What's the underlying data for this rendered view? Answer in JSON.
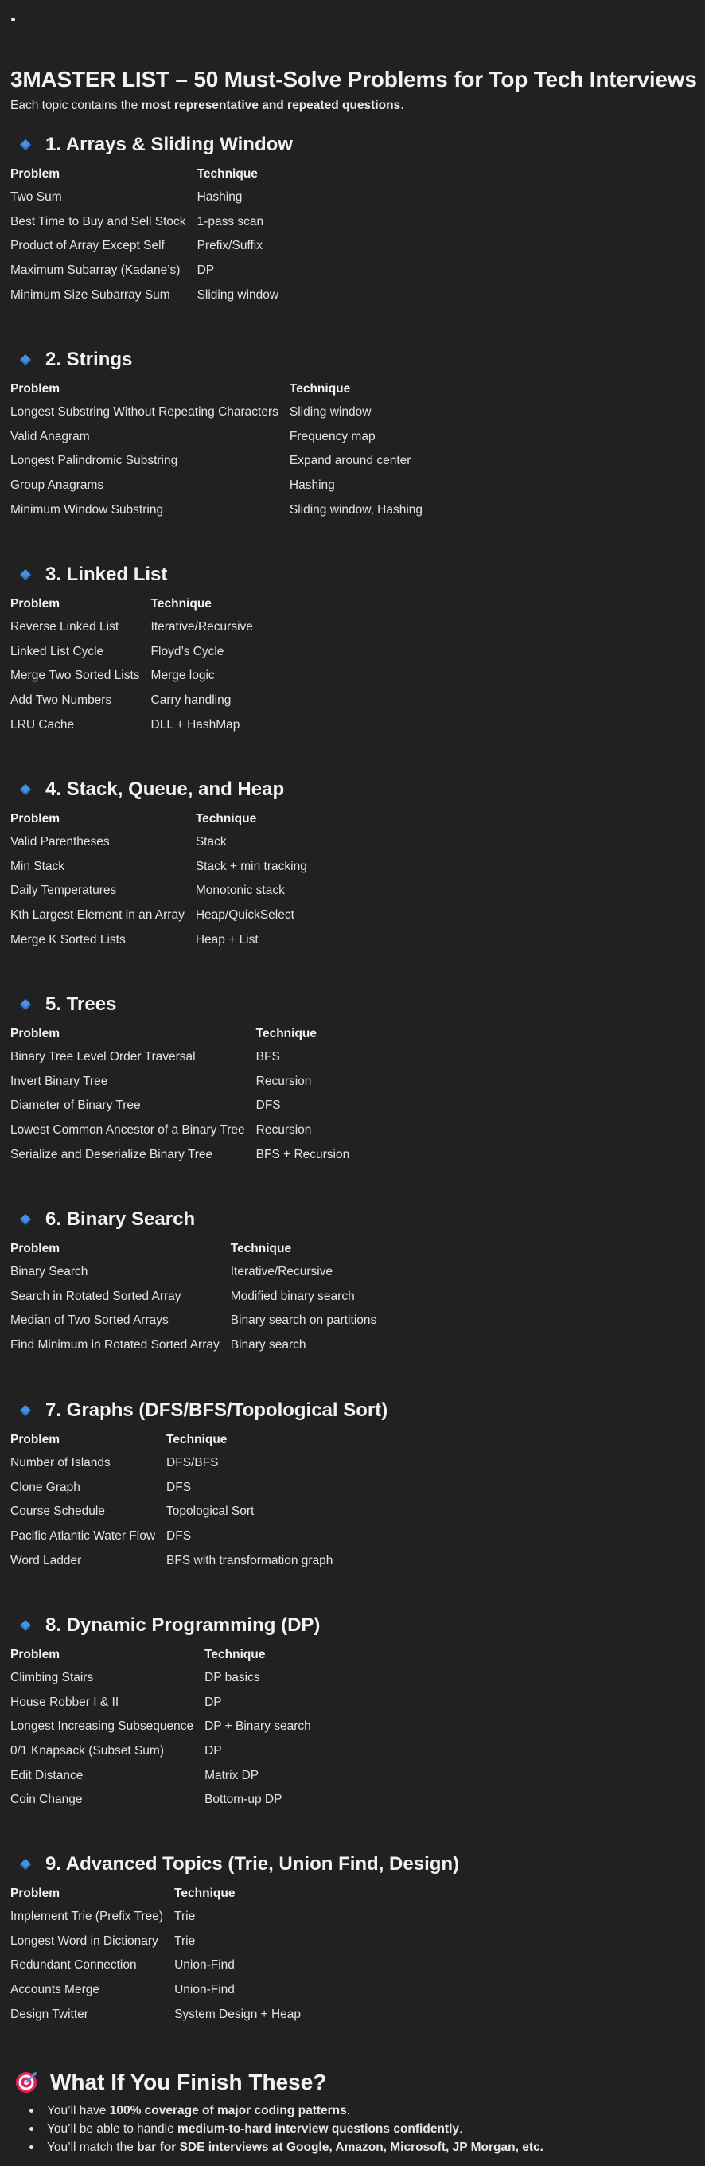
{
  "top_bullet": "•",
  "title": "3MASTER LIST – 50 Must-Solve Problems for Top Tech Interviews",
  "intro": {
    "prefix": "Each topic contains the ",
    "bold": "most representative and repeated questions",
    "suffix": "."
  },
  "header_problem": "Problem",
  "header_technique": "Technique",
  "sections": [
    {
      "title": "1. Arrays & Sliding Window",
      "rows": [
        [
          "Two Sum",
          "Hashing"
        ],
        [
          "Best Time to Buy and Sell Stock",
          "1-pass scan"
        ],
        [
          "Product of Array Except Self",
          "Prefix/Suffix"
        ],
        [
          "Maximum Subarray (Kadane’s)",
          "DP"
        ],
        [
          "Minimum Size Subarray Sum",
          "Sliding window"
        ]
      ]
    },
    {
      "title": "2. Strings",
      "rows": [
        [
          "Longest Substring Without Repeating Characters",
          "Sliding window"
        ],
        [
          "Valid Anagram",
          "Frequency map"
        ],
        [
          "Longest Palindromic Substring",
          "Expand around center"
        ],
        [
          "Group Anagrams",
          "Hashing"
        ],
        [
          "Minimum Window Substring",
          "Sliding window, Hashing"
        ]
      ]
    },
    {
      "title": "3. Linked List",
      "rows": [
        [
          "Reverse Linked List",
          "Iterative/Recursive"
        ],
        [
          "Linked List Cycle",
          "Floyd’s Cycle"
        ],
        [
          "Merge Two Sorted Lists",
          "Merge logic"
        ],
        [
          "Add Two Numbers",
          "Carry handling"
        ],
        [
          "LRU Cache",
          "DLL + HashMap"
        ]
      ]
    },
    {
      "title": "4. Stack, Queue, and Heap",
      "rows": [
        [
          "Valid Parentheses",
          "Stack"
        ],
        [
          "Min Stack",
          "Stack + min tracking"
        ],
        [
          "Daily Temperatures",
          "Monotonic stack"
        ],
        [
          "Kth Largest Element in an Array",
          "Heap/QuickSelect"
        ],
        [
          "Merge K Sorted Lists",
          "Heap + List"
        ]
      ]
    },
    {
      "title": "5. Trees",
      "rows": [
        [
          "Binary Tree Level Order Traversal",
          "BFS"
        ],
        [
          "Invert Binary Tree",
          "Recursion"
        ],
        [
          "Diameter of Binary Tree",
          "DFS"
        ],
        [
          "Lowest Common Ancestor of a Binary Tree",
          "Recursion"
        ],
        [
          "Serialize and Deserialize Binary Tree",
          "BFS + Recursion"
        ]
      ]
    },
    {
      "title": "6. Binary Search",
      "rows": [
        [
          "Binary Search",
          "Iterative/Recursive"
        ],
        [
          "Search in Rotated Sorted Array",
          "Modified binary search"
        ],
        [
          "Median of Two Sorted Arrays",
          "Binary search on partitions"
        ],
        [
          "Find Minimum in Rotated Sorted Array",
          "Binary search"
        ]
      ]
    },
    {
      "title": "7. Graphs (DFS/BFS/Topological Sort)",
      "rows": [
        [
          "Number of Islands",
          "DFS/BFS"
        ],
        [
          "Clone Graph",
          "DFS"
        ],
        [
          "Course Schedule",
          "Topological Sort"
        ],
        [
          "Pacific Atlantic Water Flow",
          "DFS"
        ],
        [
          "Word Ladder",
          "BFS with transformation graph"
        ]
      ]
    },
    {
      "title": "8. Dynamic Programming (DP)",
      "rows": [
        [
          "Climbing Stairs",
          "DP basics"
        ],
        [
          "House Robber I & II",
          "DP"
        ],
        [
          "Longest Increasing Subsequence",
          "DP + Binary search"
        ],
        [
          "0/1 Knapsack (Subset Sum)",
          "DP"
        ],
        [
          "Edit Distance",
          "Matrix DP"
        ],
        [
          "Coin Change",
          "Bottom-up DP"
        ]
      ]
    },
    {
      "title": "9. Advanced Topics (Trie, Union Find, Design)",
      "rows": [
        [
          "Implement Trie (Prefix Tree)",
          "Trie"
        ],
        [
          "Longest Word in Dictionary",
          "Trie"
        ],
        [
          "Redundant Connection",
          "Union-Find"
        ],
        [
          "Accounts Merge",
          "Union-Find"
        ],
        [
          "Design Twitter",
          "System Design + Heap"
        ]
      ]
    }
  ],
  "finish": {
    "title": "What If You Finish These?",
    "items": [
      {
        "prefix": "You’ll have ",
        "bold": "100% coverage of major coding patterns",
        "suffix": "."
      },
      {
        "prefix": "You’ll be able to handle ",
        "bold": "medium-to-hard interview questions confidently",
        "suffix": "."
      },
      {
        "prefix": "You’ll match the ",
        "bold": "bar for SDE interviews at Google, Amazon, Microsoft, JP Morgan, etc.",
        "suffix": ""
      }
    ]
  },
  "colors": {
    "background": "#212121",
    "text": "#e8e8e8",
    "diamond": "#4a90e2",
    "target_red": "#e0245e"
  }
}
